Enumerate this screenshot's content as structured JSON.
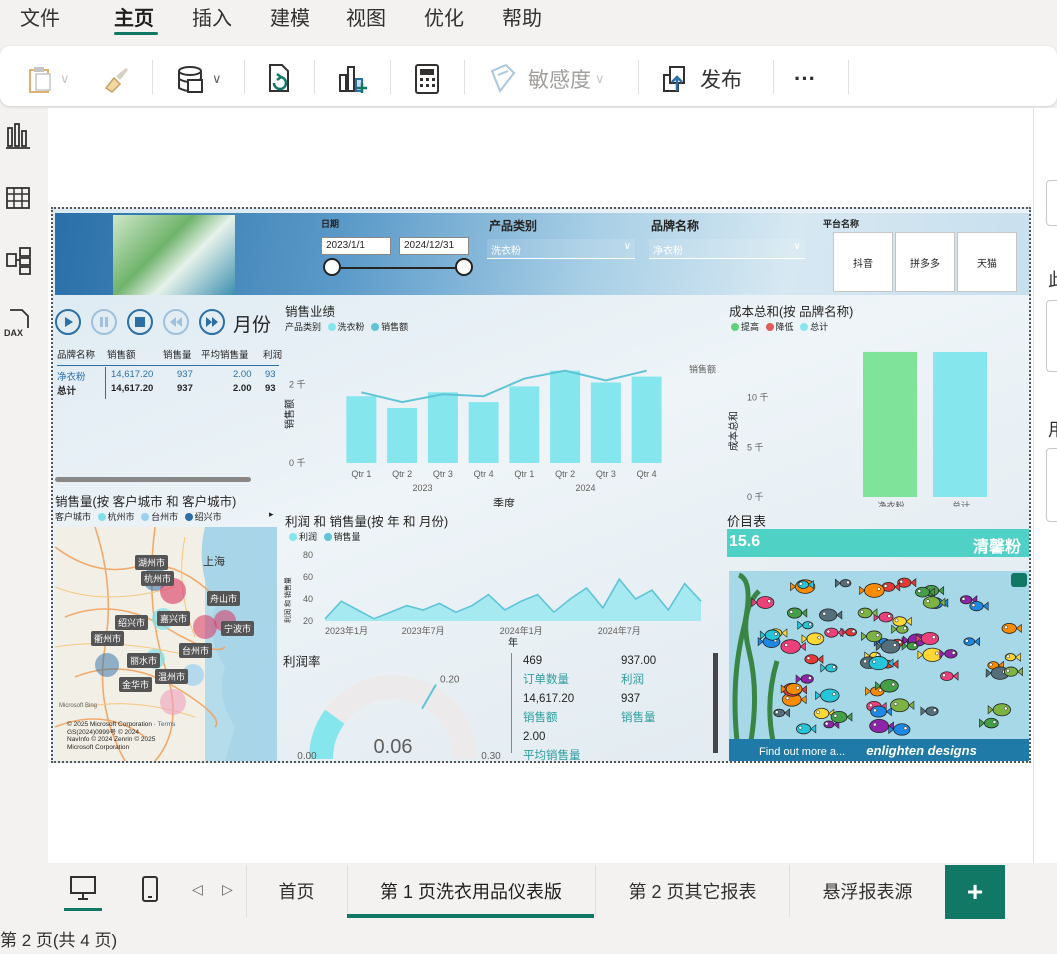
{
  "menu": {
    "items": [
      "文件",
      "主页",
      "插入",
      "建模",
      "视图",
      "优化",
      "帮助"
    ],
    "active_index": 1
  },
  "toolbar": {
    "sensitivity_label": "敏感度",
    "publish_label": "发布",
    "more_label": "···"
  },
  "report": {
    "date_slicer": {
      "title": "日期",
      "start": "2023/1/1",
      "end": "2024/12/31"
    },
    "category_slicer": {
      "title": "产品类别",
      "value": "洗衣粉"
    },
    "brand_slicer": {
      "title": "品牌名称",
      "value": "净衣粉"
    },
    "platform_slicer": {
      "title": "平台名称",
      "options": [
        "抖音",
        "拼多多",
        "天猫"
      ]
    },
    "playback": {
      "label": "月份"
    },
    "table": {
      "headers": [
        "品牌名称",
        "销售额",
        "销售量",
        "平均销售量",
        "利润"
      ],
      "rows": [
        [
          "净衣粉",
          "14,617.20",
          "937",
          "2.00",
          "93"
        ]
      ],
      "total": [
        "总计",
        "14,617.20",
        "937",
        "2.00",
        "93"
      ]
    },
    "map": {
      "title": "销售量(按 客户城市 和 客户城市)",
      "legend_title": "客户城市",
      "legend": [
        "杭州市",
        "台州市",
        "绍兴市"
      ],
      "legend_colors": [
        "#7ee0e8",
        "#9ad0f0",
        "#2b6fa5"
      ],
      "cities": [
        "湖州市",
        "杭州市",
        "上海",
        "舟山市",
        "绍兴市",
        "嘉兴市",
        "宁波市",
        "衢州市",
        "丽水市",
        "台州市",
        "温州市",
        "金华市"
      ],
      "credits": [
        "© 2025 Microsoft Corporation",
        "Terms",
        "GS(2024)0999号",
        "© 2024",
        "NavInfo © 2024 Zenrin",
        "© 2025",
        "Microsoft Corporation"
      ],
      "bing": "Microsoft Bing"
    },
    "sales_chart": {
      "title": "销售业绩",
      "legend_title": "产品类别",
      "legend": [
        "洗衣粉",
        "销售额"
      ],
      "legend_colors": [
        "#86e6ee",
        "#5fc4d8"
      ],
      "line_label": "销售额"
    },
    "cost_chart": {
      "title": "成本总和(按 品牌名称)",
      "legend": [
        "提高",
        "降低",
        "总计"
      ],
      "legend_colors": [
        "#5fd17e",
        "#e05a5a",
        "#86e6ee"
      ],
      "ylabel": "成本总和"
    },
    "profit_chart": {
      "title": "利润 和 销售量(按 年 和 月份)",
      "legend": [
        "利润",
        "销售量"
      ],
      "legend_colors": [
        "#86e6ee",
        "#5fc4d8"
      ],
      "ylabel": "利润 和 销售量"
    },
    "gauge": {
      "title": "利润率",
      "value_label": "0.06",
      "min_label": "0.00",
      "max_label": "0.30",
      "target_label": "0.20"
    },
    "kpi": {
      "items": [
        {
          "value": "469",
          "label": "订单数量"
        },
        {
          "value": "937.00",
          "label": "利润"
        },
        {
          "value": "14,617.20",
          "label": "销售额"
        },
        {
          "value": "937",
          "label": "销售量"
        },
        {
          "value": "2.00",
          "label": "平均销售量"
        }
      ]
    },
    "pivot": {
      "title": "价目表",
      "left": "15.6",
      "right": "清馨粉"
    },
    "fish_footer": {
      "link": "Find out more a...",
      "brand": "enlighten designs"
    }
  },
  "chart_data": [
    {
      "type": "bar",
      "title": "销售业绩",
      "xlabel": "季度",
      "ylabel": "销售额",
      "categories": [
        "Qtr 1",
        "Qtr 2",
        "Qtr 3",
        "Qtr 4",
        "Qtr 1",
        "Qtr 2",
        "Qtr 3",
        "Qtr 4"
      ],
      "groups": [
        "2023",
        "2024"
      ],
      "series": [
        {
          "name": "洗衣粉",
          "values": [
            1700,
            1400,
            1800,
            1550,
            1950,
            2350,
            2050,
            2200
          ]
        },
        {
          "name": "销售额",
          "values": [
            1800,
            1550,
            1750,
            1700,
            2150,
            2350,
            2100,
            2350
          ]
        }
      ],
      "yticks": [
        "0 千",
        "2 千"
      ],
      "ylim": [
        0,
        2800
      ]
    },
    {
      "type": "bar",
      "title": "成本总和(按 品牌名称)",
      "ylabel": "成本总和",
      "categories": [
        "净衣粉",
        "总计"
      ],
      "values": [
        14.6,
        14.6
      ],
      "yticks": [
        "0 千",
        "5 千",
        "10 千"
      ],
      "ylim": [
        0,
        15.5
      ]
    },
    {
      "type": "area",
      "title": "利润 和 销售量(按 年 和 月份)",
      "xlabel": "年",
      "x_ticks": [
        "2023年1月",
        "2023年7月",
        "2024年1月",
        "2024年7月"
      ],
      "y_ticks": [
        "20",
        "40",
        "60",
        "80"
      ],
      "ylim": [
        20,
        80
      ],
      "series": [
        {
          "name": "利润",
          "values": [
            22,
            38,
            30,
            22,
            28,
            34,
            30,
            36,
            28,
            34,
            44,
            30,
            38,
            44,
            28,
            40,
            50,
            32,
            58,
            40,
            48,
            30,
            54,
            38
          ]
        }
      ]
    },
    {
      "type": "gauge",
      "title": "利润率",
      "value": 0.06,
      "min": 0.0,
      "max": 0.3,
      "target": 0.2
    }
  ],
  "pages": {
    "tabs": [
      "首页",
      "第 1 页洗衣用品仪表版",
      "第 2 页其它报表",
      "悬浮报表源"
    ],
    "active_index": 1,
    "add_label": "+"
  },
  "status": {
    "text": "第 2 页(共 4 页)"
  },
  "right_panel": {
    "chars": [
      "此",
      "用"
    ]
  }
}
